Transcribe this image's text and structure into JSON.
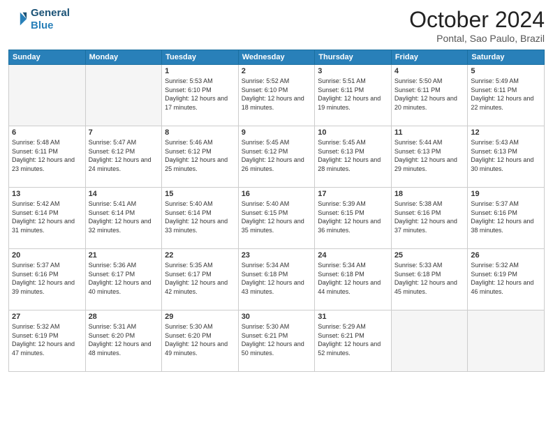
{
  "header": {
    "logo_line1": "General",
    "logo_line2": "Blue",
    "month_title": "October 2024",
    "location": "Pontal, Sao Paulo, Brazil"
  },
  "weekdays": [
    "Sunday",
    "Monday",
    "Tuesday",
    "Wednesday",
    "Thursday",
    "Friday",
    "Saturday"
  ],
  "weeks": [
    [
      {
        "day": "",
        "info": ""
      },
      {
        "day": "",
        "info": ""
      },
      {
        "day": "1",
        "info": "Sunrise: 5:53 AM\nSunset: 6:10 PM\nDaylight: 12 hours and 17 minutes."
      },
      {
        "day": "2",
        "info": "Sunrise: 5:52 AM\nSunset: 6:10 PM\nDaylight: 12 hours and 18 minutes."
      },
      {
        "day": "3",
        "info": "Sunrise: 5:51 AM\nSunset: 6:11 PM\nDaylight: 12 hours and 19 minutes."
      },
      {
        "day": "4",
        "info": "Sunrise: 5:50 AM\nSunset: 6:11 PM\nDaylight: 12 hours and 20 minutes."
      },
      {
        "day": "5",
        "info": "Sunrise: 5:49 AM\nSunset: 6:11 PM\nDaylight: 12 hours and 22 minutes."
      }
    ],
    [
      {
        "day": "6",
        "info": "Sunrise: 5:48 AM\nSunset: 6:11 PM\nDaylight: 12 hours and 23 minutes."
      },
      {
        "day": "7",
        "info": "Sunrise: 5:47 AM\nSunset: 6:12 PM\nDaylight: 12 hours and 24 minutes."
      },
      {
        "day": "8",
        "info": "Sunrise: 5:46 AM\nSunset: 6:12 PM\nDaylight: 12 hours and 25 minutes."
      },
      {
        "day": "9",
        "info": "Sunrise: 5:45 AM\nSunset: 6:12 PM\nDaylight: 12 hours and 26 minutes."
      },
      {
        "day": "10",
        "info": "Sunrise: 5:45 AM\nSunset: 6:13 PM\nDaylight: 12 hours and 28 minutes."
      },
      {
        "day": "11",
        "info": "Sunrise: 5:44 AM\nSunset: 6:13 PM\nDaylight: 12 hours and 29 minutes."
      },
      {
        "day": "12",
        "info": "Sunrise: 5:43 AM\nSunset: 6:13 PM\nDaylight: 12 hours and 30 minutes."
      }
    ],
    [
      {
        "day": "13",
        "info": "Sunrise: 5:42 AM\nSunset: 6:14 PM\nDaylight: 12 hours and 31 minutes."
      },
      {
        "day": "14",
        "info": "Sunrise: 5:41 AM\nSunset: 6:14 PM\nDaylight: 12 hours and 32 minutes."
      },
      {
        "day": "15",
        "info": "Sunrise: 5:40 AM\nSunset: 6:14 PM\nDaylight: 12 hours and 33 minutes."
      },
      {
        "day": "16",
        "info": "Sunrise: 5:40 AM\nSunset: 6:15 PM\nDaylight: 12 hours and 35 minutes."
      },
      {
        "day": "17",
        "info": "Sunrise: 5:39 AM\nSunset: 6:15 PM\nDaylight: 12 hours and 36 minutes."
      },
      {
        "day": "18",
        "info": "Sunrise: 5:38 AM\nSunset: 6:16 PM\nDaylight: 12 hours and 37 minutes."
      },
      {
        "day": "19",
        "info": "Sunrise: 5:37 AM\nSunset: 6:16 PM\nDaylight: 12 hours and 38 minutes."
      }
    ],
    [
      {
        "day": "20",
        "info": "Sunrise: 5:37 AM\nSunset: 6:16 PM\nDaylight: 12 hours and 39 minutes."
      },
      {
        "day": "21",
        "info": "Sunrise: 5:36 AM\nSunset: 6:17 PM\nDaylight: 12 hours and 40 minutes."
      },
      {
        "day": "22",
        "info": "Sunrise: 5:35 AM\nSunset: 6:17 PM\nDaylight: 12 hours and 42 minutes."
      },
      {
        "day": "23",
        "info": "Sunrise: 5:34 AM\nSunset: 6:18 PM\nDaylight: 12 hours and 43 minutes."
      },
      {
        "day": "24",
        "info": "Sunrise: 5:34 AM\nSunset: 6:18 PM\nDaylight: 12 hours and 44 minutes."
      },
      {
        "day": "25",
        "info": "Sunrise: 5:33 AM\nSunset: 6:18 PM\nDaylight: 12 hours and 45 minutes."
      },
      {
        "day": "26",
        "info": "Sunrise: 5:32 AM\nSunset: 6:19 PM\nDaylight: 12 hours and 46 minutes."
      }
    ],
    [
      {
        "day": "27",
        "info": "Sunrise: 5:32 AM\nSunset: 6:19 PM\nDaylight: 12 hours and 47 minutes."
      },
      {
        "day": "28",
        "info": "Sunrise: 5:31 AM\nSunset: 6:20 PM\nDaylight: 12 hours and 48 minutes."
      },
      {
        "day": "29",
        "info": "Sunrise: 5:30 AM\nSunset: 6:20 PM\nDaylight: 12 hours and 49 minutes."
      },
      {
        "day": "30",
        "info": "Sunrise: 5:30 AM\nSunset: 6:21 PM\nDaylight: 12 hours and 50 minutes."
      },
      {
        "day": "31",
        "info": "Sunrise: 5:29 AM\nSunset: 6:21 PM\nDaylight: 12 hours and 52 minutes."
      },
      {
        "day": "",
        "info": ""
      },
      {
        "day": "",
        "info": ""
      }
    ]
  ]
}
